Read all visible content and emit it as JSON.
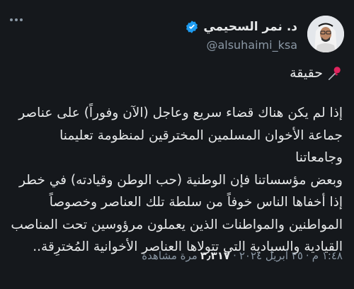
{
  "author": {
    "name": "د. نمر السحيمي",
    "handle": "@alsuhaimi_ksa",
    "verified": true
  },
  "icons": {
    "more": "more-horizontal-icon",
    "verified": "verified-badge-icon",
    "pin": "pushpin-icon"
  },
  "colors": {
    "background": "#15181c",
    "text": "#e7e9ea",
    "muted": "#8b98a5",
    "verified_blue": "#1d9bf0",
    "pin_red": "#e0245e"
  },
  "tweet": {
    "headline": "حقيقة",
    "lines": [
      "إذا لم يكن هناك قضاء سريع وعاجل (الآن وفوراً) على عناصر",
      "جماعة الأخوان المسلمين المخترقين لمنظومة تعليمنا وجامعاتنا",
      "وبعض مؤسساتنا فإن الوطنية (حب الوطن وقيادته) في خطر",
      "إذا أخفاها الناس خوفاً من سلطة تلك العناصر وخصوصاً",
      "المواطنين والمواطنات الذين يعملون مرؤوسين تحت المناصب",
      "القيادية والسيادية التي تتولاها العناصر الأخوانية المُخترِقة.."
    ]
  },
  "meta": {
    "time": "١:٤٨ م",
    "separator": "·",
    "date": "٢٥ أبريل ٢٠٢٤",
    "views_count": "٣٫٣١٧",
    "views_label": "مرة مشاهدة"
  }
}
